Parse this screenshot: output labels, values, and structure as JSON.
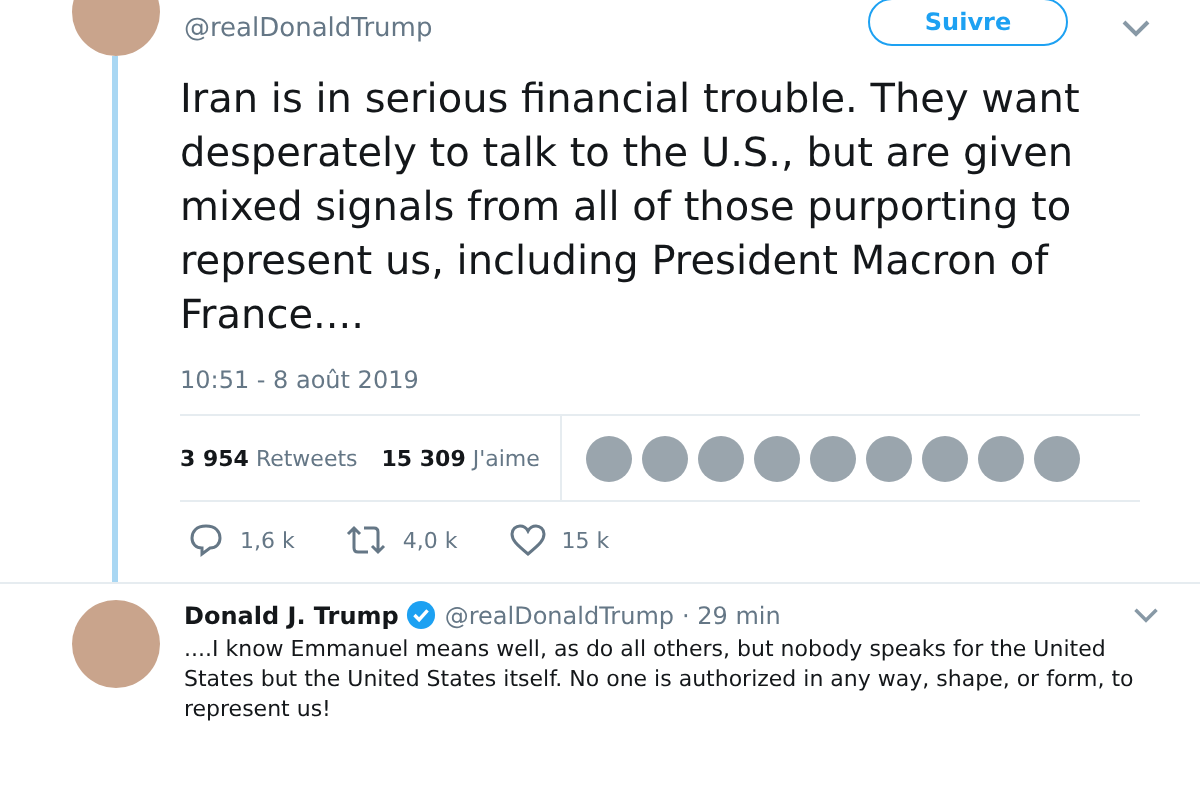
{
  "tweet": {
    "handle": "@realDonaldTrump",
    "follow_button": "Suivre",
    "text": "Iran is in serious financial trouble. They want desperately to talk to the U.S., but are given mixed signals from all of those purporting to represent us, including President Macron of France....",
    "timestamp": "10:51 - 8 août 2019",
    "stats": [
      {
        "count": "3 954",
        "label": "Retweets"
      },
      {
        "count": "15 309",
        "label": "J'aime"
      }
    ],
    "actions": [
      {
        "kind": "reply",
        "count": "1,6 k"
      },
      {
        "kind": "retweet",
        "count": "4,0 k"
      },
      {
        "kind": "like",
        "count": "15 k"
      }
    ]
  },
  "reply": {
    "name": "Donald J. Trump",
    "verified": true,
    "handle": "@realDonaldTrump",
    "time": "· 29 min",
    "text": "....I know Emmanuel means well, as do all others, but nobody speaks for the United States but the United States itself. No one is authorized in any way, shape, or form, to represent us!"
  }
}
